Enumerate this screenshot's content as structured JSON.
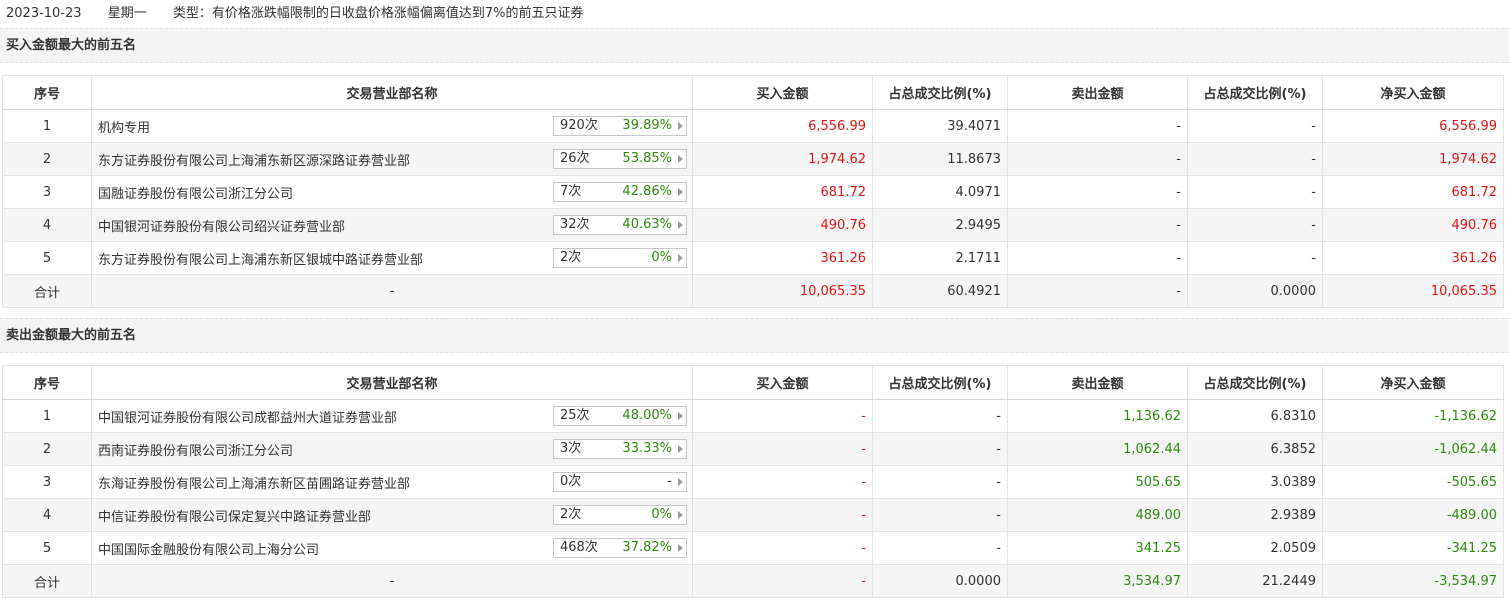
{
  "header": {
    "date": "2023-10-23",
    "weekday": "星期一",
    "type_text": "类型：有价格涨跌幅限制的日收盘价格涨幅偏离值达到7%的前五只证券"
  },
  "columns": [
    "序号",
    "交易营业部名称",
    "买入金额",
    "占总成交比例(%)",
    "卖出金额",
    "占总成交比例(%)",
    "净买入金额"
  ],
  "buy_section": {
    "title": "买入金额最大的前五名",
    "rows": [
      {
        "no": "1",
        "name": "机构专用",
        "times": "920次",
        "ratio": "39.89%",
        "buy": "6,556.99",
        "buy_pct": "39.4071",
        "sell": "-",
        "sell_pct": "-",
        "net": "6,556.99"
      },
      {
        "no": "2",
        "name": "东方证券股份有限公司上海浦东新区源深路证券营业部",
        "times": "26次",
        "ratio": "53.85%",
        "buy": "1,974.62",
        "buy_pct": "11.8673",
        "sell": "-",
        "sell_pct": "-",
        "net": "1,974.62"
      },
      {
        "no": "3",
        "name": "国融证券股份有限公司浙江分公司",
        "times": "7次",
        "ratio": "42.86%",
        "buy": "681.72",
        "buy_pct": "4.0971",
        "sell": "-",
        "sell_pct": "-",
        "net": "681.72"
      },
      {
        "no": "4",
        "name": "中国银河证券股份有限公司绍兴证券营业部",
        "times": "32次",
        "ratio": "40.63%",
        "buy": "490.76",
        "buy_pct": "2.9495",
        "sell": "-",
        "sell_pct": "-",
        "net": "490.76"
      },
      {
        "no": "5",
        "name": "东方证券股份有限公司上海浦东新区银城中路证券营业部",
        "times": "2次",
        "ratio": "0%",
        "buy": "361.26",
        "buy_pct": "2.1711",
        "sell": "-",
        "sell_pct": "-",
        "net": "361.26"
      }
    ],
    "total": {
      "label": "合计",
      "name": "-",
      "buy": "10,065.35",
      "buy_pct": "60.4921",
      "sell": "-",
      "sell_pct": "0.0000",
      "net": "10,065.35"
    }
  },
  "sell_section": {
    "title": "卖出金额最大的前五名",
    "rows": [
      {
        "no": "1",
        "name": "中国银河证券股份有限公司成都益州大道证券营业部",
        "times": "25次",
        "ratio": "48.00%",
        "buy": "-",
        "buy_pct": "-",
        "sell": "1,136.62",
        "sell_pct": "6.8310",
        "net": "-1,136.62"
      },
      {
        "no": "2",
        "name": "西南证券股份有限公司浙江分公司",
        "times": "3次",
        "ratio": "33.33%",
        "buy": "-",
        "buy_pct": "-",
        "sell": "1,062.44",
        "sell_pct": "6.3852",
        "net": "-1,062.44"
      },
      {
        "no": "3",
        "name": "东海证券股份有限公司上海浦东新区苗圃路证券营业部",
        "times": "0次",
        "ratio": "-",
        "buy": "-",
        "buy_pct": "-",
        "sell": "505.65",
        "sell_pct": "3.0389",
        "net": "-505.65"
      },
      {
        "no": "4",
        "name": "中信证券股份有限公司保定复兴中路证券营业部",
        "times": "2次",
        "ratio": "0%",
        "buy": "-",
        "buy_pct": "-",
        "sell": "489.00",
        "sell_pct": "2.9389",
        "net": "-489.00"
      },
      {
        "no": "5",
        "name": "中国国际金融股份有限公司上海分公司",
        "times": "468次",
        "ratio": "37.82%",
        "buy": "-",
        "buy_pct": "-",
        "sell": "341.25",
        "sell_pct": "2.0509",
        "net": "-341.25"
      }
    ],
    "total": {
      "label": "合计",
      "name": "-",
      "buy": "-",
      "buy_pct": "0.0000",
      "sell": "3,534.97",
      "sell_pct": "21.2449",
      "net": "-3,534.97"
    }
  }
}
